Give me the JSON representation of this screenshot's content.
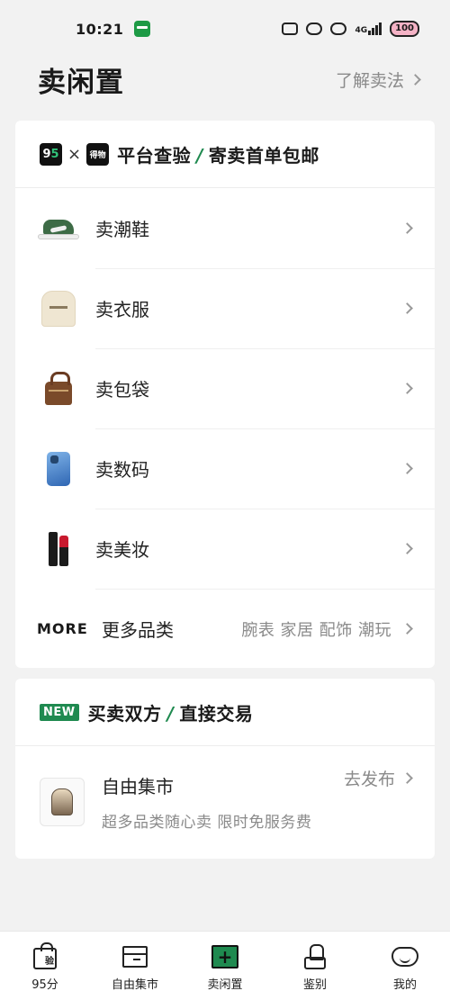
{
  "status_bar": {
    "time": "10:21",
    "network": "4G",
    "battery": "100"
  },
  "header": {
    "title": "卖闲置",
    "link": "了解卖法"
  },
  "sell_card": {
    "logo_95": {
      "left": "9",
      "right": "5"
    },
    "times": "×",
    "logo_dw": "得物",
    "headline_a": "平台查验",
    "slash": "/",
    "headline_b": "寄卖首单包邮",
    "rows": [
      {
        "label": "卖潮鞋"
      },
      {
        "label": "卖衣服"
      },
      {
        "label": "卖包袋"
      },
      {
        "label": "卖数码"
      },
      {
        "label": "卖美妆"
      }
    ],
    "more": {
      "word": "MORE",
      "label": "更多品类",
      "tags": "腕表 家居 配饰 潮玩"
    }
  },
  "market_card": {
    "badge": "NEW",
    "headline_a": "买卖双方",
    "slash": "/",
    "headline_b": "直接交易",
    "title": "自由集市",
    "subtitle": "超多品类随心卖 限时免服务费",
    "action": "去发布"
  },
  "tabbar": {
    "tabs": [
      {
        "label": "95分",
        "glyph": "验"
      },
      {
        "label": "自由集市"
      },
      {
        "label": "卖闲置",
        "glyph": "+"
      },
      {
        "label": "鉴别"
      },
      {
        "label": "我的"
      }
    ]
  },
  "colors": {
    "accent": "#1f8a50",
    "background": "#f2f2f2",
    "muted_text": "#8a8a8a"
  }
}
